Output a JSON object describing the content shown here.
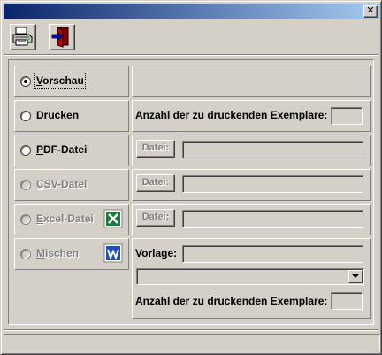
{
  "window": {
    "close_label": "✕"
  },
  "toolbar": {
    "print_icon": "printer-icon",
    "exit_icon": "exit-door-icon"
  },
  "options": [
    {
      "label": "Vorschau",
      "accel": "V",
      "rest": "orschau",
      "selected": true,
      "enabled": true
    },
    {
      "label": "Drucken",
      "accel": "D",
      "rest": "rucken",
      "selected": false,
      "enabled": true
    },
    {
      "label": "PDF-Datei",
      "accel": "P",
      "rest": "DF-Datei",
      "selected": false,
      "enabled": true
    },
    {
      "label": "CSV-Datei",
      "accel": "C",
      "rest": "SV-Datei",
      "selected": false,
      "enabled": false
    },
    {
      "label": "Excel-Datei",
      "accel": "E",
      "rest": "xcel-Datei",
      "selected": false,
      "enabled": false,
      "icon": "excel-icon"
    },
    {
      "label": "Mischen",
      "accel": "M",
      "rest": "ischen",
      "selected": false,
      "enabled": false,
      "icon": "word-icon"
    }
  ],
  "drucken": {
    "copies_label": "Anzahl der zu druckenden Exemplare:",
    "copies_value": ""
  },
  "pdf": {
    "file_button": "Datei:",
    "file_value": ""
  },
  "csv": {
    "file_button": "Datei:",
    "file_value": ""
  },
  "excel": {
    "file_button": "Datei:",
    "file_value": ""
  },
  "mischen": {
    "template_label": "Vorlage:",
    "template_value": "",
    "select_value": "",
    "copies_label": "Anzahl der zu druckenden Exemplare:",
    "copies_value": ""
  },
  "colors": {
    "title_start": "#0a246a",
    "title_end": "#a6caf0",
    "face": "#d4d0c8"
  }
}
